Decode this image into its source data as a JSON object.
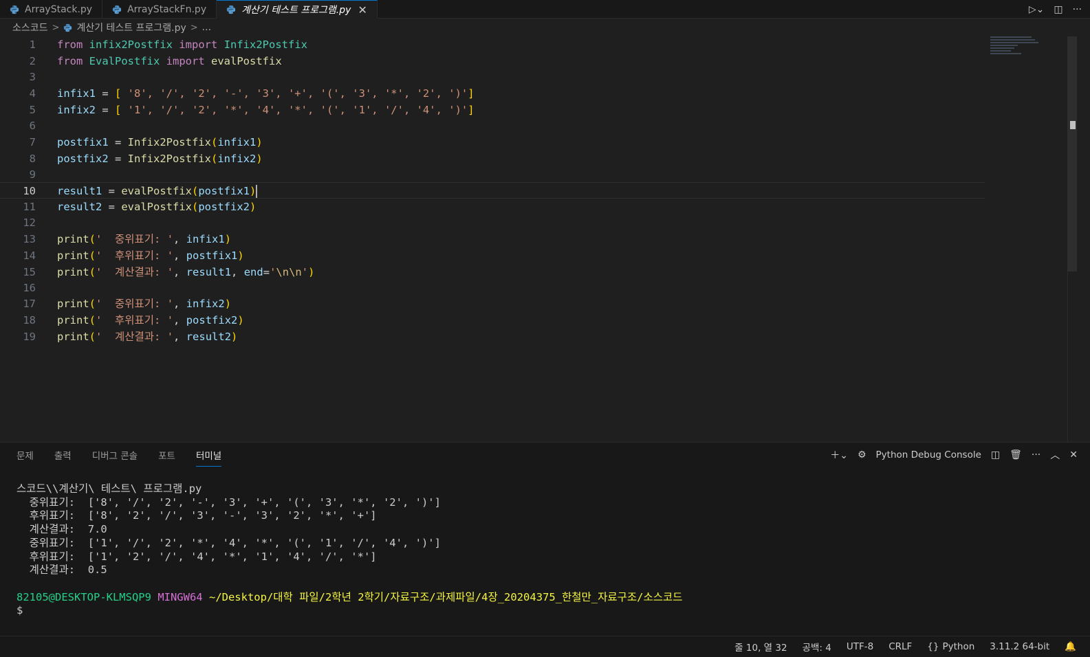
{
  "tabs": [
    {
      "label": "ArrayStack.py",
      "active": false
    },
    {
      "label": "ArrayStackFn.py",
      "active": false
    },
    {
      "label": "계산기 테스트 프로그램.py",
      "active": true
    }
  ],
  "breadcrumb": {
    "folder": "소스코드",
    "file": "계산기 테스트 프로그램.py",
    "more": "..."
  },
  "editor": {
    "current_line": 10,
    "lines": [
      {
        "n": "1"
      },
      {
        "n": "2"
      },
      {
        "n": "3"
      },
      {
        "n": "4"
      },
      {
        "n": "5"
      },
      {
        "n": "6"
      },
      {
        "n": "7"
      },
      {
        "n": "8"
      },
      {
        "n": "9"
      },
      {
        "n": "10"
      },
      {
        "n": "11"
      },
      {
        "n": "12"
      },
      {
        "n": "13"
      },
      {
        "n": "14"
      },
      {
        "n": "15"
      },
      {
        "n": "16"
      },
      {
        "n": "17"
      },
      {
        "n": "18"
      },
      {
        "n": "19"
      }
    ],
    "code": {
      "l1": {
        "kw1": "from",
        "mod": "infix2Postfix",
        "kw2": "import",
        "name": "Infix2Postfix"
      },
      "l2": {
        "kw1": "from",
        "mod": "EvalPostfix",
        "kw2": "import",
        "name": "evalPostfix"
      },
      "l4": {
        "var": "infix1",
        "items": "'8', '/', '2', '-', '3', '+', '(', '3', '*', '2', ')'"
      },
      "l5": {
        "var": "infix2",
        "items": "'1', '/', '2', '*', '4', '*', '(', '1', '/', '4', ')'"
      },
      "l7": {
        "var": "postfix1",
        "fn": "Infix2Postfix",
        "arg": "infix1"
      },
      "l8": {
        "var": "postfix2",
        "fn": "Infix2Postfix",
        "arg": "infix2"
      },
      "l10": {
        "var": "result1",
        "fn": "evalPostfix",
        "arg": "postfix1"
      },
      "l11": {
        "var": "result2",
        "fn": "evalPostfix",
        "arg": "postfix2"
      },
      "l13": {
        "fn": "print",
        "str": "'  중위표기: '",
        "arg": "infix1"
      },
      "l14": {
        "fn": "print",
        "str": "'  후위표기: '",
        "arg": "postfix1"
      },
      "l15": {
        "fn": "print",
        "str": "'  계산결과: '",
        "arg": "result1",
        "kwarg": "end",
        "end_str1": "'",
        "end_esc": "\\n\\n",
        "end_str2": "'"
      },
      "l17": {
        "fn": "print",
        "str": "'  중위표기: '",
        "arg": "infix2"
      },
      "l18": {
        "fn": "print",
        "str": "'  후위표기: '",
        "arg": "postfix2"
      },
      "l19": {
        "fn": "print",
        "str": "'  계산결과: '",
        "arg": "result2"
      }
    }
  },
  "panel": {
    "tabs": [
      "문제",
      "출력",
      "디버그 콘솔",
      "포트",
      "터미널"
    ],
    "active_tab": "터미널",
    "console_label": "Python Debug Console"
  },
  "terminal": {
    "lines": [
      "스코드\\\\계산기\\ 테스트\\ 프로그램.py",
      "  중위표기:  ['8', '/', '2', '-', '3', '+', '(', '3', '*', '2', ')']",
      "  후위표기:  ['8', '2', '/', '3', '-', '3', '2', '*', '+']",
      "  계산결과:  7.0",
      "",
      "  중위표기:  ['1', '/', '2', '*', '4', '*', '(', '1', '/', '4', ')']",
      "  후위표기:  ['1', '2', '/', '4', '*', '1', '4', '/', '*']",
      "  계산결과:  0.5",
      ""
    ],
    "prompt_user": "82105@DESKTOP-KLMSQP9",
    "prompt_env": "MINGW64",
    "prompt_path": "~/Desktop/대학 파일/2학년 2학기/자료구조/과제파일/4장_20204375_한철만_자료구조/소스코드",
    "prompt_symbol": "$"
  },
  "statusbar": {
    "position": "줄 10, 열 32",
    "spaces": "공백: 4",
    "encoding": "UTF-8",
    "eol": "CRLF",
    "language": "Python",
    "interpreter": "3.11.2 64-bit"
  },
  "colors": {
    "accent": "#0078d4",
    "bg": "#1f1f1f",
    "panel_bg": "#181818"
  }
}
